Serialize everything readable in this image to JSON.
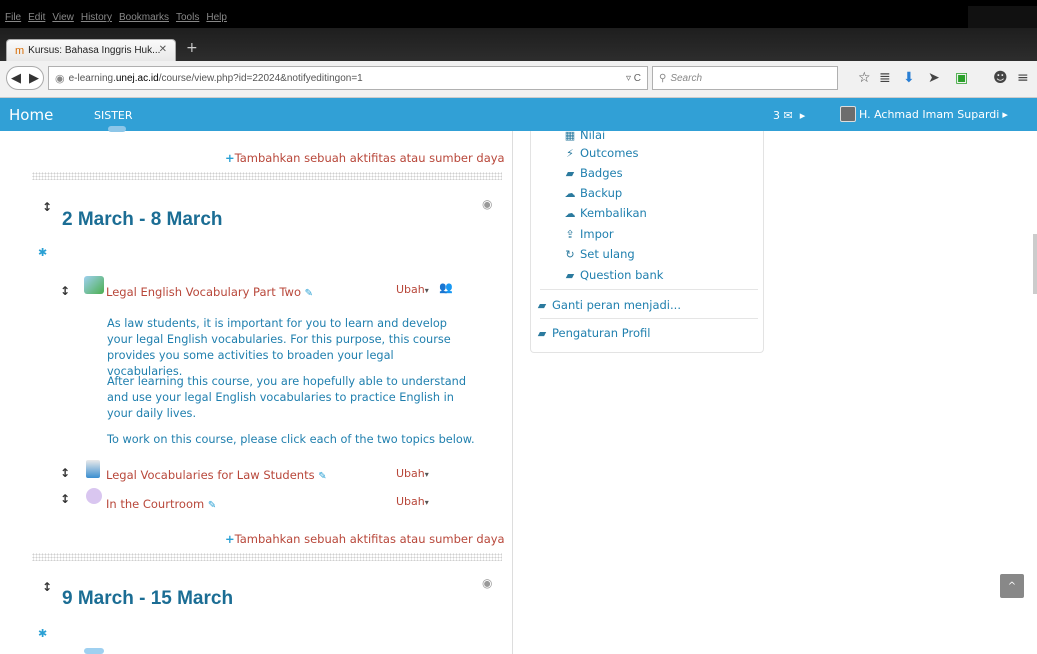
{
  "browser": {
    "menu": [
      "File",
      "Edit",
      "View",
      "History",
      "Bookmarks",
      "Tools",
      "Help"
    ],
    "tab_title": "Kursus: Bahasa Inggris Huk...",
    "url_prefix": "e-learning.",
    "url_domain": "unej.ac.id",
    "url_path": "/course/view.php?id=22024&notifyeditingon=1",
    "search_placeholder": "Search"
  },
  "nav": {
    "home": "Home",
    "sister": "SISTER",
    "messages_count": "3",
    "user_name": "H. Achmad Imam Supardi"
  },
  "course": {
    "add_activity": "Tambahkan sebuah aktifitas atau sumber daya",
    "sections": [
      {
        "title": "2 March - 8 March",
        "activities": [
          {
            "name": "Legal English Vocabulary Part Two",
            "edit": "Ubah"
          },
          {
            "name": "Legal Vocabularies for Law Students",
            "edit": "Ubah"
          },
          {
            "name": "In the Courtroom",
            "edit": "Ubah"
          }
        ],
        "paragraphs": [
          "As law students, it is important for you to learn and develop your legal English vocabularies. For this purpose, this course provides you some activities to broaden your legal vocabularies.",
          "After learning this course, you are hopefully able to understand and use your legal English vocabularies to practice English in your daily lives.",
          "To work on this course, please click each of the two topics below."
        ]
      },
      {
        "title": "9 March - 15 March"
      }
    ]
  },
  "admin_block": {
    "items": [
      {
        "label": "Nilai",
        "icon": "table-icon"
      },
      {
        "label": "Outcomes",
        "icon": "magic-wand-icon"
      },
      {
        "label": "Badges",
        "icon": "folder-icon"
      },
      {
        "label": "Backup",
        "icon": "cloud-upload-icon"
      },
      {
        "label": "Kembalikan",
        "icon": "cloud-download-icon"
      },
      {
        "label": "Impor",
        "icon": "upload-icon"
      },
      {
        "label": "Set ulang",
        "icon": "refresh-icon"
      },
      {
        "label": "Question bank",
        "icon": "folder-icon"
      }
    ],
    "switch_role": "Ganti peran menjadi...",
    "profile_settings": "Pengaturan Profil"
  }
}
